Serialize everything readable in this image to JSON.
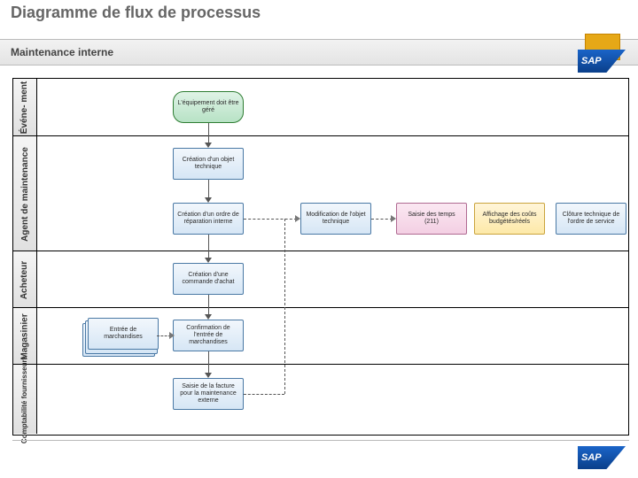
{
  "title": "Diagramme de flux de processus",
  "subtitle": "Maintenance interne",
  "logo_text": "SAP",
  "lanes": [
    {
      "label": "Événe-\nment"
    },
    {
      "label": "Agent de maintenance"
    },
    {
      "label": "Acheteur"
    },
    {
      "label": "Magasinier"
    },
    {
      "label": "Comptabilité\nfournisseurs"
    }
  ],
  "nodes": {
    "event1": "L'équipement doit être géré",
    "create_obj": "Création d'un objet technique",
    "create_order": "Création d'un ordre de réparation interne",
    "mod_obj": "Modification de l'objet technique",
    "time_entry": "Saisie des temps (211)",
    "disp_cost": "Affichage des coûts budgétés/réels",
    "tech_close": "Clôture technique de l'ordre de service",
    "create_po": "Création d'une commande d'achat",
    "goods_in": "Entrée de marchandises",
    "confirm_goods": "Confirmation de l'entrée de marchandises",
    "invoice": "Saisie de la facture pour la maintenance externe"
  }
}
